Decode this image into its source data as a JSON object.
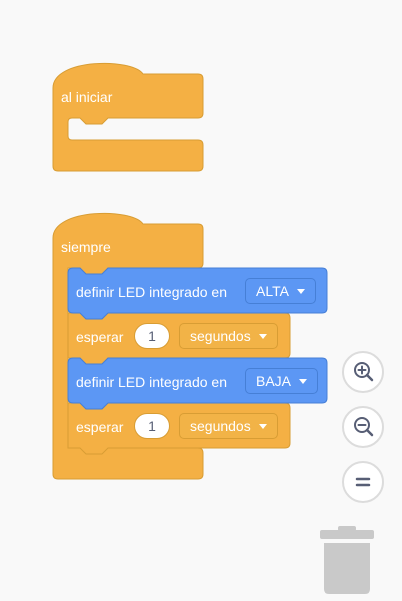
{
  "workspace": {
    "block_colors": {
      "control": "#f4b044",
      "control_border": "#d89d34",
      "hardware": "#5c97f4",
      "hardware_border": "#467fd6"
    },
    "hat_on_start": {
      "label": "al iniciar"
    },
    "loop_forever": {
      "label": "siempre",
      "statements": [
        {
          "type": "set_led",
          "label": "definir LED integrado en",
          "value": "ALTA"
        },
        {
          "type": "wait",
          "label": "esperar",
          "amount": "1",
          "unit": "segundos"
        },
        {
          "type": "set_led",
          "label": "definir LED integrado en",
          "value": "BAJA"
        },
        {
          "type": "wait",
          "label": "esperar",
          "amount": "1",
          "unit": "segundos"
        }
      ]
    }
  },
  "controls": {
    "zoom_in_icon": "zoom-in-icon",
    "zoom_out_icon": "zoom-out-icon",
    "zoom_reset_icon": "zoom-reset-icon",
    "trash_icon": "trash-icon"
  }
}
